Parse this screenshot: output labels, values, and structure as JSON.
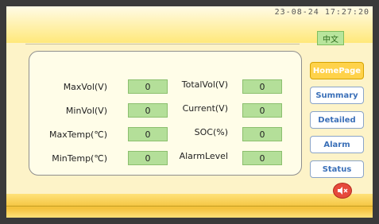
{
  "header": {
    "clock": "23-08-24 17:27:20",
    "language_label": "中文"
  },
  "fields": {
    "max_vol_label": "MaxVol(V)",
    "max_vol_value": "0",
    "min_vol_label": "MinVol(V)",
    "min_vol_value": "0",
    "max_temp_label": "MaxTemp(℃)",
    "max_temp_value": "0",
    "min_temp_label": "MinTemp(℃)",
    "min_temp_value": "0",
    "total_vol_label": "TotalVol(V)",
    "total_vol_value": "0",
    "current_label": "Current(V)",
    "current_value": "0",
    "soc_label": "SOC(%)",
    "soc_value": "0",
    "alarm_level_label": "AlarmLevel",
    "alarm_level_value": "0"
  },
  "nav": {
    "home": "HomePage",
    "summary": "Summary",
    "detailed": "Detailed",
    "alarm": "Alarm",
    "status": "Status",
    "active": "HomePage"
  },
  "colors": {
    "accent": "#ffd24a",
    "value_box": "#b4df99",
    "nav_text": "#3a6fb8",
    "sound_button": "#e64a3c"
  },
  "icons": {
    "sound": "speaker-mute-icon"
  }
}
